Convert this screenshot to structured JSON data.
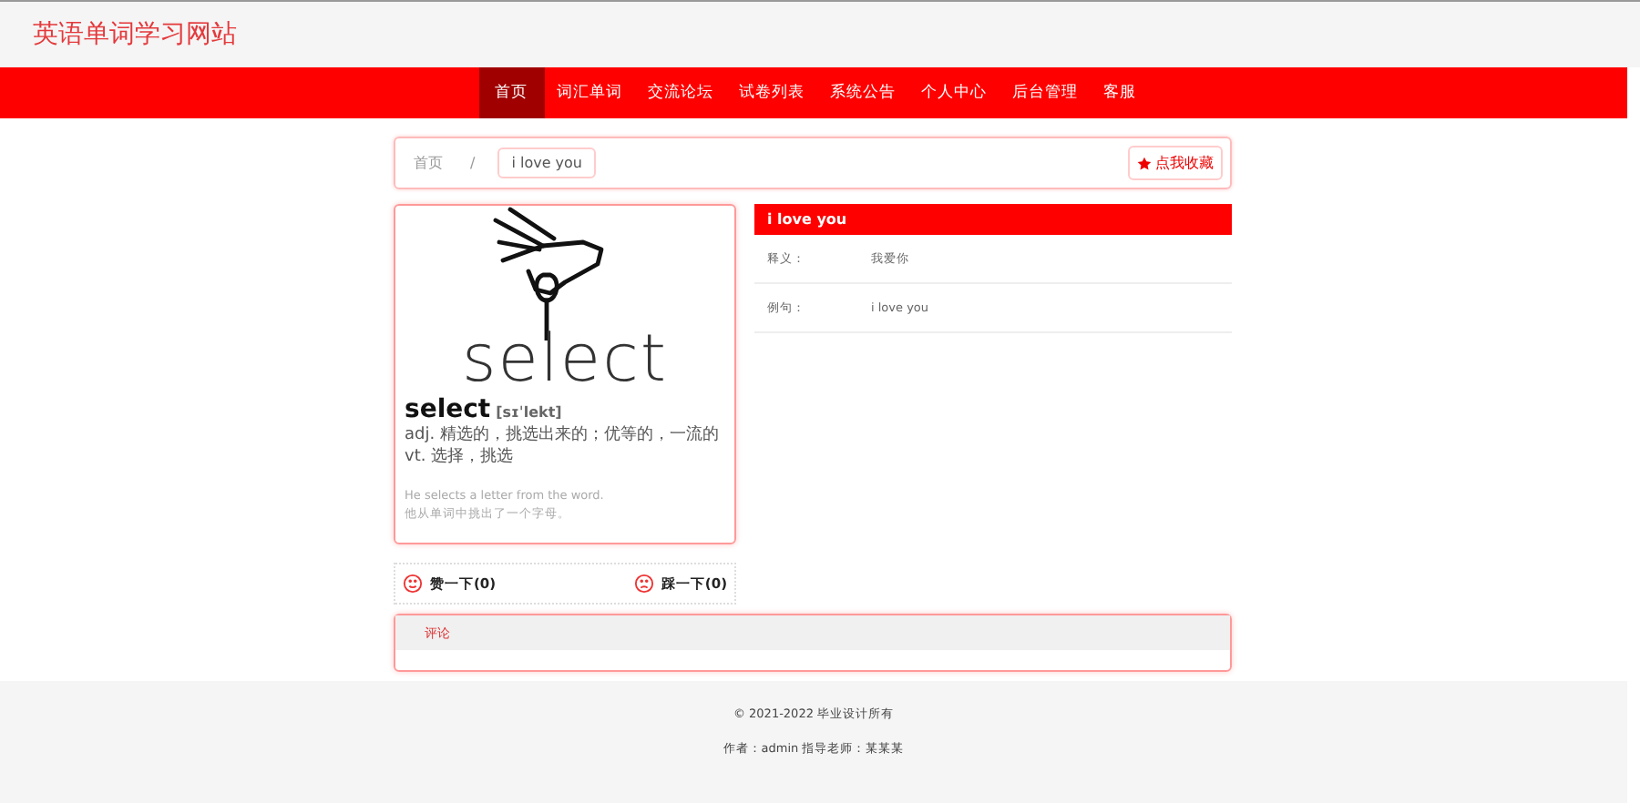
{
  "site_title": "英语单词学习网站",
  "nav": [
    {
      "label": "首页",
      "selected": true
    },
    {
      "label": "词汇单词",
      "selected": false
    },
    {
      "label": "交流论坛",
      "selected": false
    },
    {
      "label": "试卷列表",
      "selected": false
    },
    {
      "label": "系统公告",
      "selected": false
    },
    {
      "label": "个人中心",
      "selected": false
    },
    {
      "label": "后台管理",
      "selected": false
    },
    {
      "label": "客服",
      "selected": false
    }
  ],
  "breadcrumb": {
    "home": "首页",
    "separator": "/",
    "current": "i love you",
    "favorite_button": "点我收藏"
  },
  "word_card": {
    "image_word": "select",
    "headword": "select",
    "phonetic": "[sɪˈlekt]",
    "definitions": [
      "adj. 精选的，挑选出来的；优等的，一流的",
      "vt. 选择，挑选"
    ],
    "example": "He selects a letter from the word.",
    "example_translation": "他从单词中挑出了一个字母。"
  },
  "detail": {
    "title": "i love you",
    "rows": [
      {
        "label": "释义：",
        "value": "我爱你"
      },
      {
        "label": "例句：",
        "value": "i love you"
      }
    ]
  },
  "votes": [
    {
      "kind": "like",
      "label": "赞一下(0)"
    },
    {
      "kind": "dislike",
      "label": "踩一下(0)"
    }
  ],
  "comments": {
    "title": "评论"
  },
  "footer": [
    "© 2021-2022 毕业设计所有",
    "作者：admin 指导老师：某某某"
  ]
}
